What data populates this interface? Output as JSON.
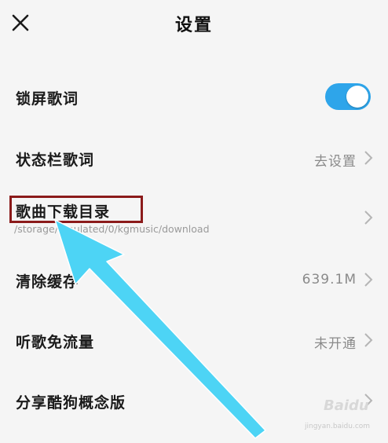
{
  "header": {
    "title": "设置",
    "close_icon": "close-icon"
  },
  "settings": [
    {
      "label": "锁屏歌词",
      "control": "toggle",
      "enabled": true,
      "toggle_color": "#2ea5ea"
    },
    {
      "label": "状态栏歌词",
      "value": "去设置"
    },
    {
      "label": "歌曲下载目录",
      "subtitle": "/storage/emulated/0/kgmusic/download"
    },
    {
      "label": "清除缓存",
      "value": "639.1M"
    },
    {
      "label": "听歌免流量",
      "value": "未开通"
    },
    {
      "label": "分享酷狗概念版"
    }
  ],
  "annotations": {
    "highlight_color": "#8b1a1a",
    "arrow_color": "#4dd4f5"
  },
  "watermark": {
    "brand": "Baidu",
    "sub": "jingyan.baidu.com"
  },
  "colors": {
    "background": "#f5f5f5",
    "text": "#1a1a1a",
    "secondary": "#8a8a8a"
  }
}
